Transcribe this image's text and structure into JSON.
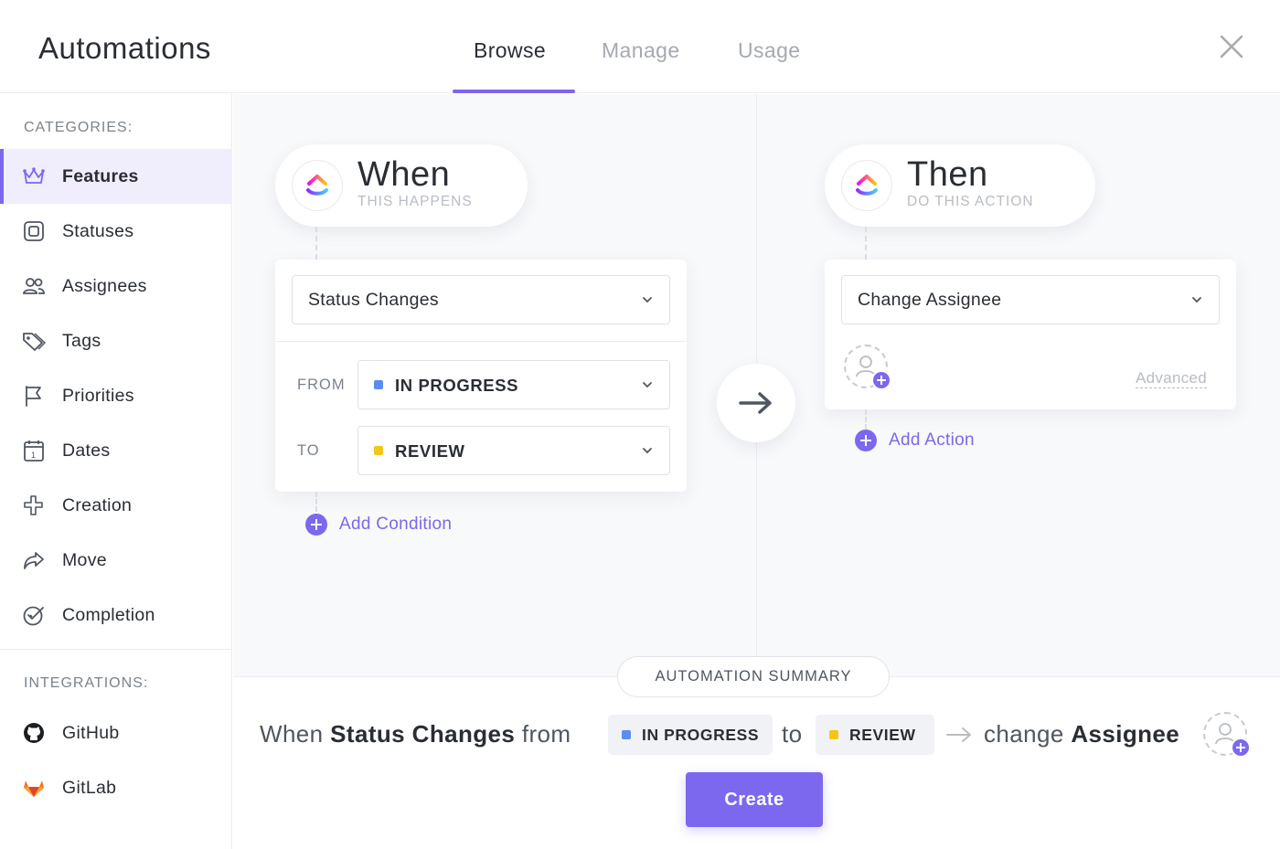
{
  "app": {
    "title": "Automations"
  },
  "tabs": [
    {
      "label": "Browse",
      "active": true
    },
    {
      "label": "Manage",
      "active": false
    },
    {
      "label": "Usage",
      "active": false
    }
  ],
  "sidebar": {
    "categories_label": "CATEGORIES:",
    "items": [
      {
        "label": "Features",
        "icon": "crown-icon",
        "active": true
      },
      {
        "label": "Statuses",
        "icon": "status-square-icon"
      },
      {
        "label": "Assignees",
        "icon": "users-icon"
      },
      {
        "label": "Tags",
        "icon": "tags-icon"
      },
      {
        "label": "Priorities",
        "icon": "flag-icon"
      },
      {
        "label": "Dates",
        "icon": "calendar-icon"
      },
      {
        "label": "Creation",
        "icon": "plus-outline-icon"
      },
      {
        "label": "Move",
        "icon": "share-arrow-icon"
      },
      {
        "label": "Completion",
        "icon": "check-circle-icon"
      }
    ],
    "integrations_label": "INTEGRATIONS:",
    "integrations": [
      {
        "label": "GitHub",
        "icon": "github-icon"
      },
      {
        "label": "GitLab",
        "icon": "gitlab-icon"
      }
    ]
  },
  "trigger": {
    "title": "When",
    "subtitle": "THIS HAPPENS",
    "select_value": "Status Changes",
    "from_label": "FROM",
    "from_value": "IN PROGRESS",
    "from_color": "#5b8def",
    "to_label": "TO",
    "to_value": "REVIEW",
    "to_color": "#f5c518",
    "add_condition": "Add Condition"
  },
  "action": {
    "title": "Then",
    "subtitle": "DO THIS ACTION",
    "select_value": "Change Assignee",
    "advanced": "Advanced",
    "add_action": "Add Action"
  },
  "summary": {
    "label": "AUTOMATION SUMMARY",
    "when": "When",
    "trigger": "Status Changes",
    "from": "from",
    "from_chip": "IN PROGRESS",
    "to": "to",
    "to_chip": "REVIEW",
    "change": "change",
    "target": "Assignee"
  },
  "create_button": "Create",
  "colors": {
    "accent": "#7b68ee"
  }
}
